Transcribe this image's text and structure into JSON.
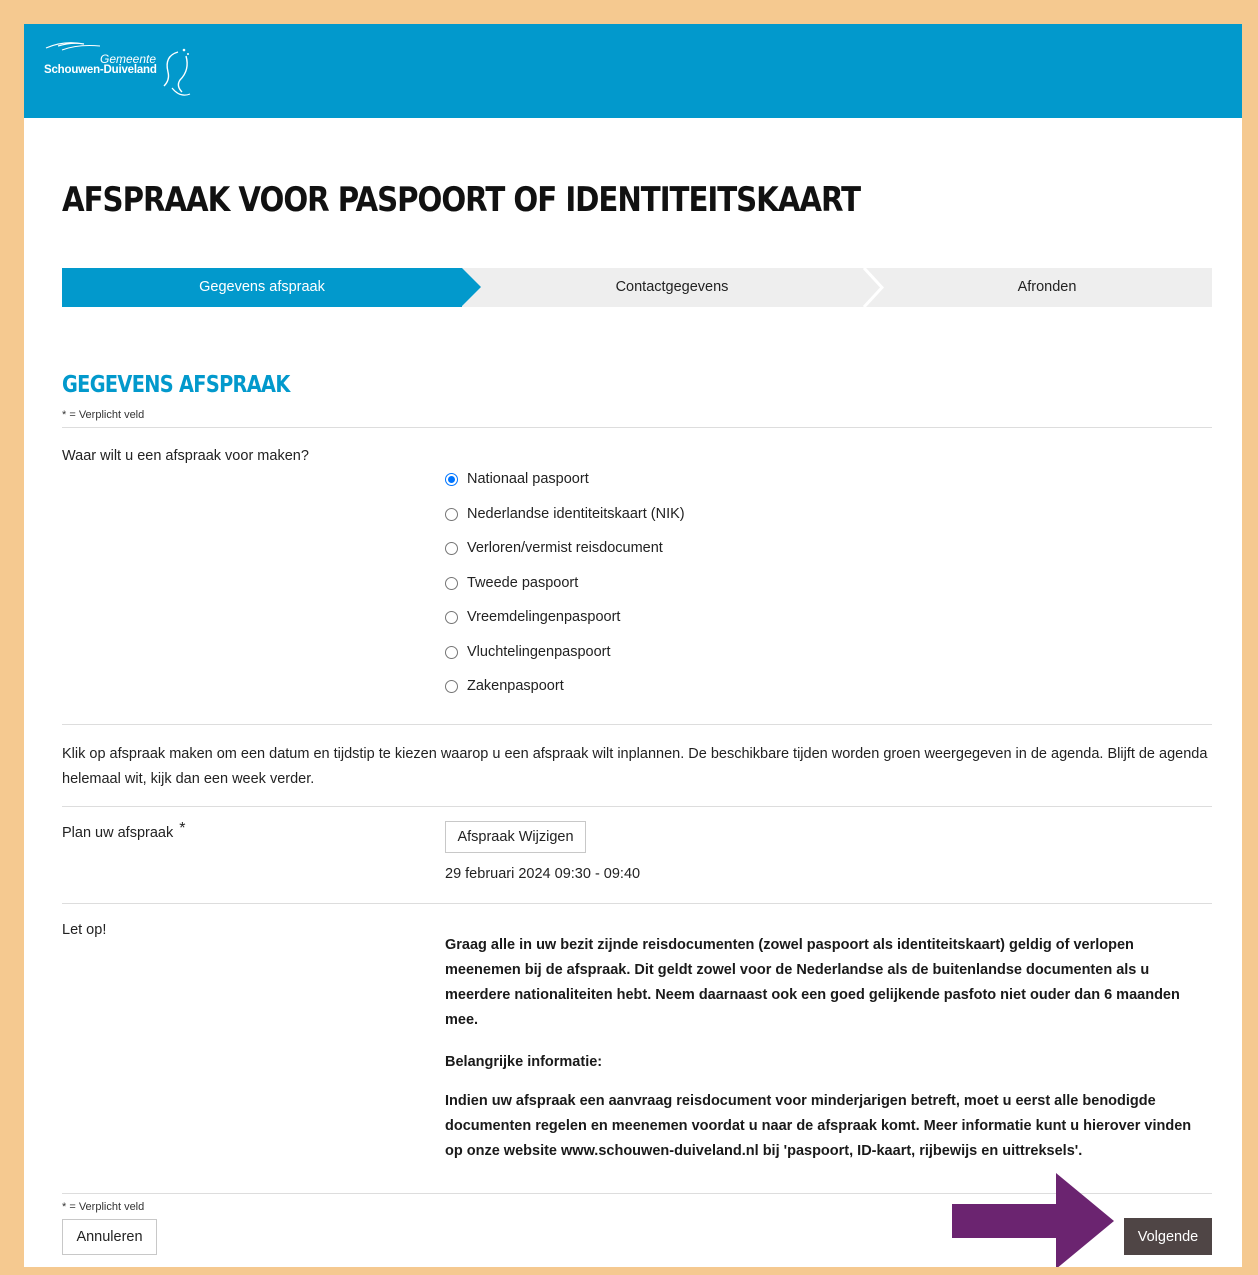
{
  "header": {
    "logo_line1": "Gemeente",
    "logo_line2": "Schouwen-Duiveland",
    "background": "#0299cc"
  },
  "page_title": "AFSPRAAK VOOR PASPOORT OF IDENTITEITSKAART",
  "steps": [
    {
      "label": "Gegevens afspraak",
      "active": true
    },
    {
      "label": "Contactgegevens",
      "active": false
    },
    {
      "label": "Afronden",
      "active": false
    }
  ],
  "section_title": "GEGEVENS AFSPRAAK",
  "required_note": "* = Verplicht veld",
  "question": {
    "label": "Waar wilt u een afspraak voor maken?",
    "options": [
      {
        "label": "Nationaal paspoort",
        "checked": true
      },
      {
        "label": "Nederlandse identiteitskaart (NIK)",
        "checked": false
      },
      {
        "label": "Verloren/vermist reisdocument",
        "checked": false
      },
      {
        "label": "Tweede paspoort",
        "checked": false
      },
      {
        "label": "Vreemdelingenpaspoort",
        "checked": false
      },
      {
        "label": "Vluchtelingenpaspoort",
        "checked": false
      },
      {
        "label": "Zakenpaspoort",
        "checked": false
      }
    ]
  },
  "info_text": "Klik op afspraak maken om een datum en tijdstip te kiezen waarop u een afspraak wilt inplannen. De beschikbare tijden worden groen weergegeven in de agenda. Blijft de agenda helemaal wit, kijk dan een week verder.",
  "plan": {
    "label": "Plan uw afspraak",
    "asterisk": "*",
    "button": "Afspraak Wijzigen",
    "appointment": "29 februari 2024 09:30 - 09:40"
  },
  "notice": {
    "label": "Let op!",
    "paragraph1": "Graag alle in uw bezit zijnde reisdocumenten (zowel paspoort als identiteitskaart) geldig of verlopen meenemen bij de afspraak. Dit geldt zowel voor de Nederlandse als de buitenlandse documenten als u meerdere nationaliteiten hebt. Neem daarnaast ook een goed gelijkende pasfoto niet ouder dan 6 maanden mee.",
    "heading": "Belangrijke informatie:",
    "paragraph2": "Indien uw afspraak een aanvraag reisdocument voor minderjarigen betreft, moet u eerst alle benodigde documenten regelen en meenemen voordat u naar de afspraak komt. Meer informatie kunt u hierover vinden op onze website www.schouwen-duiveland.nl bij 'paspoort, ID-kaart, rijbewijs en uittreksels'."
  },
  "footer": {
    "required_note": "* = Verplicht veld",
    "cancel_label": "Annuleren",
    "next_label": "Volgende"
  },
  "colors": {
    "accent": "#0299cc",
    "frame_border": "#f5c990",
    "next_button": "#4f4545",
    "annotation_arrow": "#6b2470"
  }
}
